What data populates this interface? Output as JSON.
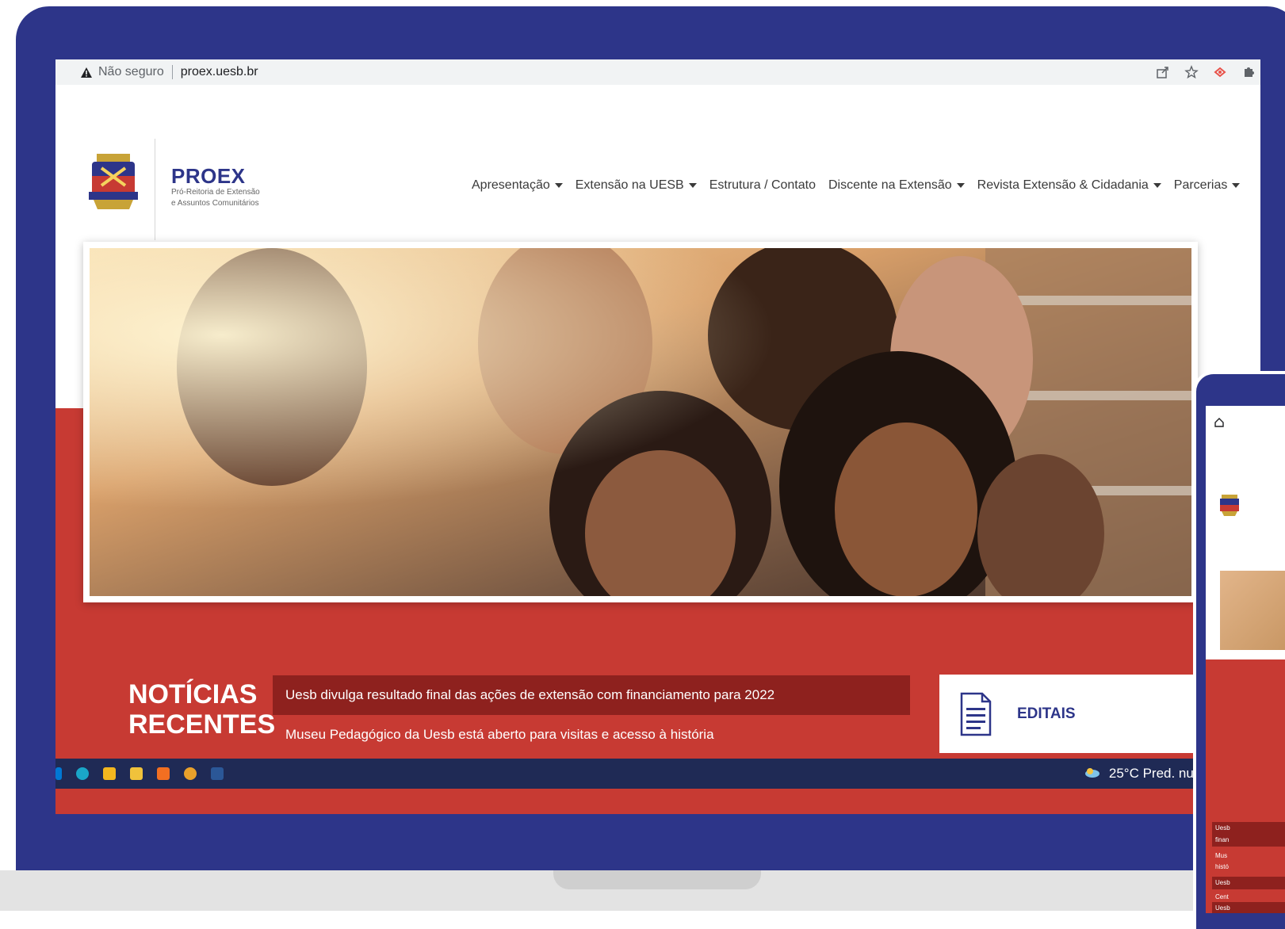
{
  "browser": {
    "security_label": "Não seguro",
    "url": "proex.uesb.br",
    "icons": [
      "share-icon",
      "star-icon",
      "extension-icon",
      "puzzle-icon"
    ]
  },
  "site": {
    "brand_title": "PROEX",
    "brand_sub_line1": "Pró-Reitoria de Extensão",
    "brand_sub_line2": "e Assuntos Comunitários",
    "nav": [
      {
        "label": "Apresentação",
        "dropdown": true
      },
      {
        "label": "Extensão na UESB",
        "dropdown": true
      },
      {
        "label": "Estrutura / Contato",
        "dropdown": false
      },
      {
        "label": "Discente na Extensão",
        "dropdown": true
      },
      {
        "label": "Revista Extensão & Cidadania",
        "dropdown": true
      },
      {
        "label": "Parcerias",
        "dropdown": true
      }
    ]
  },
  "news": {
    "heading_line1": "NOTÍCIAS",
    "heading_line2": "RECENTES",
    "items": [
      "Uesb divulga resultado final das ações de extensão com financiamento para 2022",
      "Museu Pedagógico da Uesb está aberto para visitas e acesso à história"
    ],
    "editais_label": "EDITAIS"
  },
  "taskbar": {
    "weather": "25°C Pred. nu...",
    "caret": "^"
  },
  "phone": {
    "news": [
      "Uesb",
      "finan",
      "Mus",
      "histó",
      "Uesb",
      "Cent",
      "Uesb"
    ]
  },
  "colors": {
    "navy": "#2d3589",
    "red": "#c73a33",
    "dark_red": "#8e211e"
  }
}
